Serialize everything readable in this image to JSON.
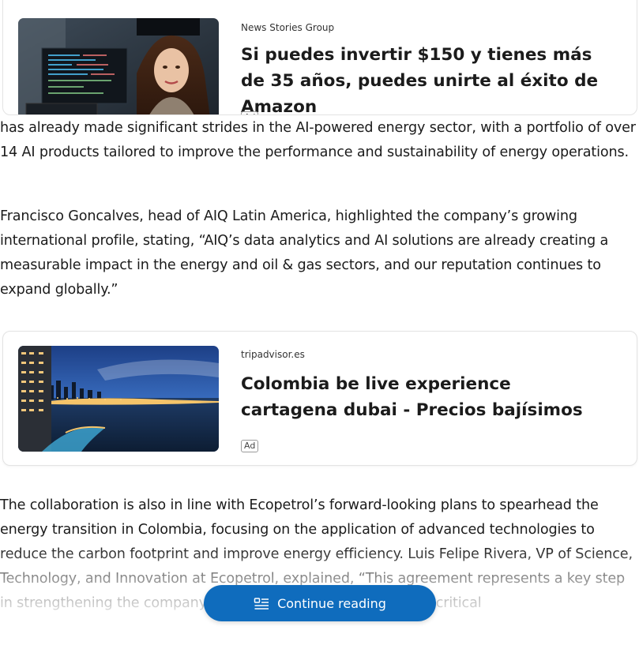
{
  "ad_top": {
    "source": "News Stories Group",
    "title": "Si puedes invertir $150 y tienes más de 35 años, puedes unirte al éxito de Amazon",
    "image": "woman-with-trading-monitors-photo"
  },
  "article": {
    "paragraph_1": "has already made significant strides in the AI-powered energy sector, with a portfolio of over 14 AI products tailored to improve the performance and sustainability of energy operations.",
    "paragraph_2": "Francisco Goncalves, head of AIQ Latin America, highlighted the company’s growing international profile, stating, “AIQ’s data analytics and AI solutions are already creating a measurable impact in the energy and oil & gas sectors, and our reputation continues to expand globally.”",
    "paragraph_3": "The collaboration is also in line with Ecopetrol’s forward-looking plans to spearhead the energy transition in Colombia, focusing on the application of advanced technologies to reduce the carbon footprint and improve energy efficiency. Luis Felipe Rivera, VP of Science, Technology, and Innovation at Ecopetrol, explained, “This agreement represents a key step in strengthening the company’s capabilities in working on AI, a critical"
  },
  "ad_mid": {
    "source": "tripadvisor.es",
    "title": "Colombia be live experience cartagena dubai - Precios bajísimos",
    "badge": "Ad",
    "image": "cartagena-coastline-night-photo"
  },
  "continue_button": {
    "label": "Continue reading",
    "icon": "reader-mode-icon",
    "color": "#0f6cbd"
  }
}
